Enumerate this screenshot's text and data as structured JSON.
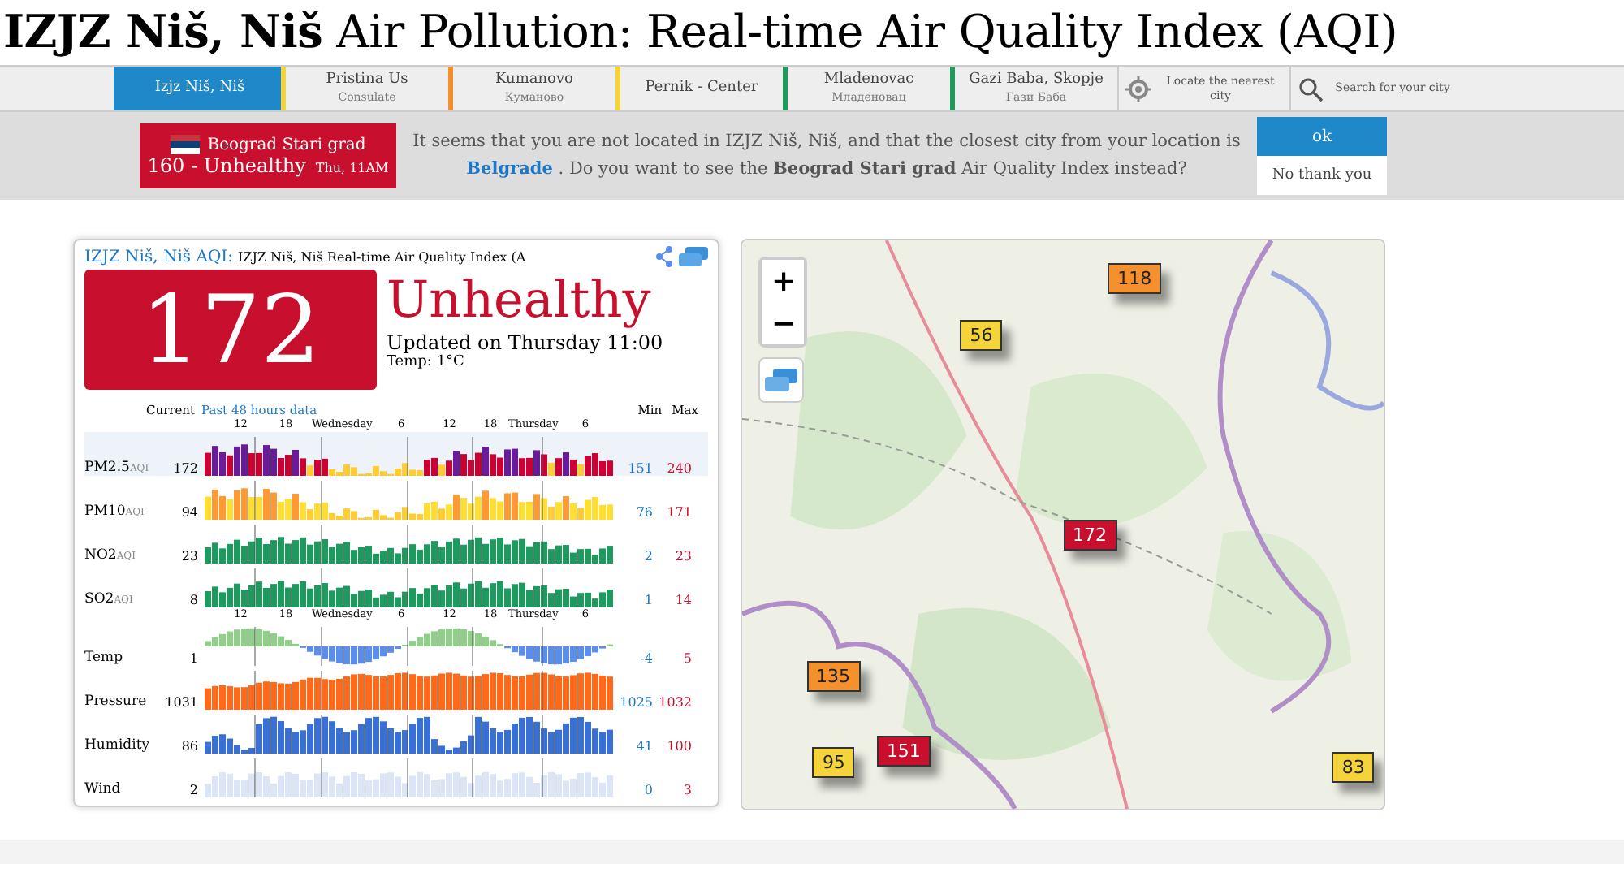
{
  "title": "**IZJZ Niš, Niš** Air Pollution: Real-time Air Quality Index (AQI)",
  "nav": [
    {
      "label": "Izjz Niš, Niš",
      "color": "#1e88c8",
      "selected": true
    },
    {
      "label": "Pristina Us",
      "sub": "Consulate",
      "color": "#f5d33b",
      "selected": false
    },
    {
      "label": "Kumanovo",
      "sub": "Куманово",
      "color": "#f5902f",
      "selected": false
    },
    {
      "label": "Pernik - Center",
      "color": "#f5d33b",
      "selected": false
    },
    {
      "label": "Mladenovac",
      "sub": "Младеновац",
      "color": "#1f9a5b",
      "selected": false
    },
    {
      "label": "Gazi Baba, Skopje",
      "sub": "Гази Баба",
      "color": "#1f9a5b",
      "selected": false
    }
  ],
  "nav_tools": [
    {
      "kind": "locate",
      "label": "Locate the nearest city"
    },
    {
      "kind": "search",
      "label": "Search for your city"
    }
  ],
  "banner": {
    "station": "Beograd Stari grad",
    "aqi": "160 - Unhealthy",
    "time": "Thu, 11AM",
    "message": "It seems that you are not located in IZJZ Niš, Niš, and that the closest city from your location is",
    "link": "Belgrade",
    "message_end": ". Do you want to see the **Beograd Stari grad** Air Quality Index instead?",
    "ok": "ok",
    "no": "No thank you"
  },
  "card": {
    "link": "IZJZ Niš, Niš AQI:",
    "subtitle": "IZJZ Niš, Niš Real-time Air Quality Index (A",
    "aqi": "172",
    "status": "Unhealthy",
    "updated": "Updated on Thursday 11:00",
    "temp": "Temp: 1°C",
    "head_current": "Current",
    "head_past": "Past 48 hours data",
    "head_min": "Min",
    "head_max": "Max",
    "axis": [
      "12",
      "18",
      "Wednesday",
      "6",
      "12",
      "18",
      "Thursday",
      "6"
    ],
    "axis_2": [
      "12",
      "18",
      "Wednesday",
      "6",
      "12",
      "18",
      "Thursday",
      "6"
    ],
    "rows": [
      {
        "kind": "aqi",
        "label": "PM2.5",
        "unit": "AQI",
        "current": "172",
        "min": "151",
        "max": "240"
      },
      {
        "kind": "aqi",
        "label": "PM10",
        "unit": "AQI",
        "current": "94",
        "min": "76",
        "max": "171"
      },
      {
        "kind": "green",
        "label": "NO2",
        "unit": "AQI",
        "current": "23",
        "min": "2",
        "max": "23"
      },
      {
        "kind": "green",
        "label": "SO2",
        "unit": "AQI",
        "current": "8",
        "min": "1",
        "max": "14"
      },
      {
        "kind": "temp",
        "label": "Temp",
        "current": "1",
        "min": "-4",
        "max": "5"
      },
      {
        "kind": "pressure",
        "label": "Pressure",
        "current": "1031",
        "min": "1025",
        "max": "1032"
      },
      {
        "kind": "humidity",
        "label": "Humidity",
        "current": "86",
        "min": "41",
        "max": "100"
      },
      {
        "kind": "wind",
        "label": "Wind",
        "current": "2",
        "min": "0",
        "max": "3"
      }
    ]
  },
  "map": {
    "zoom_in": "+",
    "zoom_out": "−",
    "markers": [
      {
        "value": "118",
        "color": "#f5902f"
      },
      {
        "value": "56",
        "color": "#f5d33b"
      },
      {
        "value": "172",
        "color": "#c8102e"
      },
      {
        "value": "135",
        "color": "#f5902f"
      },
      {
        "value": "95",
        "color": "#f5d33b"
      },
      {
        "value": "151",
        "color": "#c8102e"
      },
      {
        "value": "83",
        "color": "#f5d33b"
      }
    ]
  }
}
